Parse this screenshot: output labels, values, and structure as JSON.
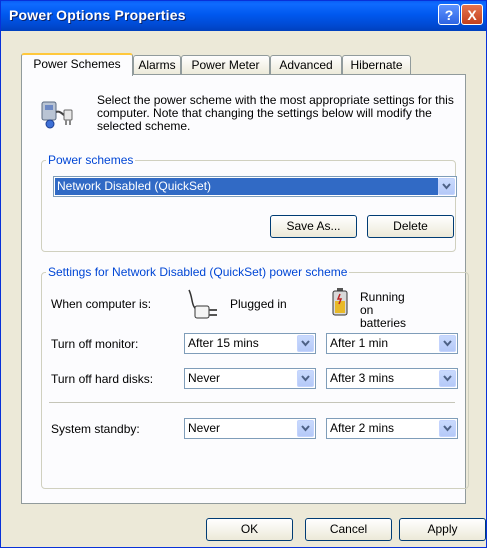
{
  "window": {
    "title": "Power Options Properties",
    "help_label": "?",
    "close_label": "X"
  },
  "tabs": [
    {
      "label": "Power Schemes",
      "active": true
    },
    {
      "label": "Alarms",
      "active": false
    },
    {
      "label": "Power Meter",
      "active": false
    },
    {
      "label": "Advanced",
      "active": false
    },
    {
      "label": "Hibernate",
      "active": false
    }
  ],
  "intro": {
    "text": "Select the power scheme with the most appropriate settings for this computer. Note that changing the settings below will modify the selected scheme.",
    "icon": "power-options-icon"
  },
  "schemes": {
    "legend": "Power schemes",
    "selected": "Network Disabled (QuickSet)",
    "save_as_label": "Save As...",
    "delete_label": "Delete"
  },
  "settings": {
    "legend": "Settings for Network Disabled (QuickSet) power scheme",
    "when_label": "When computer is:",
    "plugged_in_label": "Plugged in",
    "batteries_label": "Running on batteries",
    "rows": [
      {
        "label": "Turn off monitor:",
        "plugged": "After 15 mins",
        "battery": "After 1 min"
      },
      {
        "label": "Turn off hard disks:",
        "plugged": "Never",
        "battery": "After 3 mins"
      },
      {
        "label": "System standby:",
        "plugged": "Never",
        "battery": "After 2 mins"
      }
    ]
  },
  "footer": {
    "ok_label": "OK",
    "cancel_label": "Cancel",
    "apply_label": "Apply"
  },
  "colors": {
    "title_bar": "#0058ee",
    "selection": "#316ac5",
    "legend": "#0046d5",
    "dialog": "#ece9d8"
  }
}
